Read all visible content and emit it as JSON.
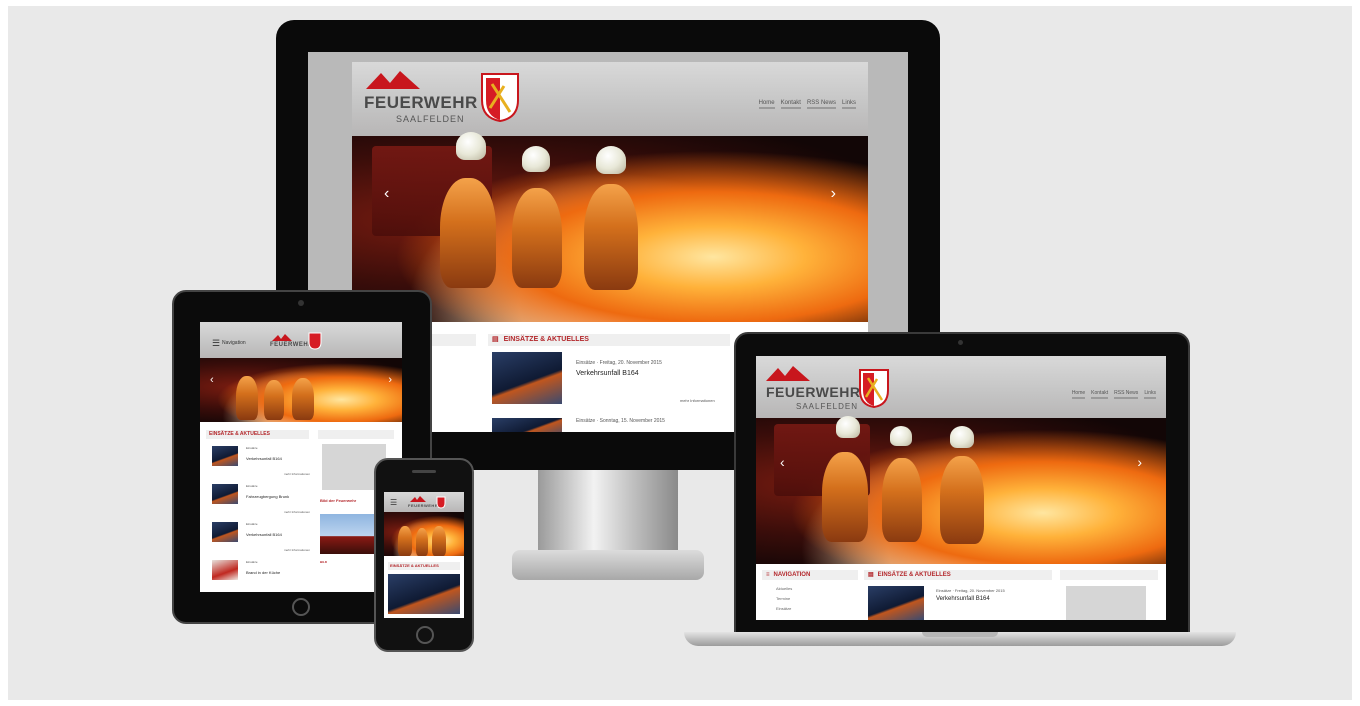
{
  "site": {
    "brand": "FEUERWEHR",
    "brand_sub": "SAALFELDEN",
    "nav": [
      "Home",
      "Kontakt",
      "RSS News",
      "Links"
    ],
    "menu_label": "Navigation"
  },
  "sections": {
    "news_heading": "EINSÄTZE & AKTUELLES",
    "navigation_heading": "NAVIGATION",
    "nav_items": [
      "Aktuelles",
      "Termine",
      "Einsätze"
    ]
  },
  "news": [
    {
      "meta_category": "Einsätze",
      "meta_date": "Freitag, 20. November 2015",
      "title": "Verkehrsunfall B164",
      "more": "mehr Informationen"
    },
    {
      "meta_category": "Einsätze",
      "meta_date": "Sonntag, 15. November 2015",
      "title": "Fahrzeugbergung Brunk",
      "more": "mehr Informationen"
    },
    {
      "meta_category": "Einsätze",
      "meta_date": "Freitag, 13. November 2015",
      "title": "Verkehrsunfall B164",
      "more": "mehr Informationen"
    },
    {
      "meta_category": "Einsätze",
      "meta_date": "Dienstag, 10. November 2015",
      "title": "Brand in der Küche",
      "more": "mehr Informationen"
    }
  ],
  "sidebar": {
    "feature_label": "Bild der Feuerwehr",
    "photo_label": "BILD"
  },
  "colors": {
    "accent": "#b3262a",
    "background": "#e9e9e9"
  }
}
